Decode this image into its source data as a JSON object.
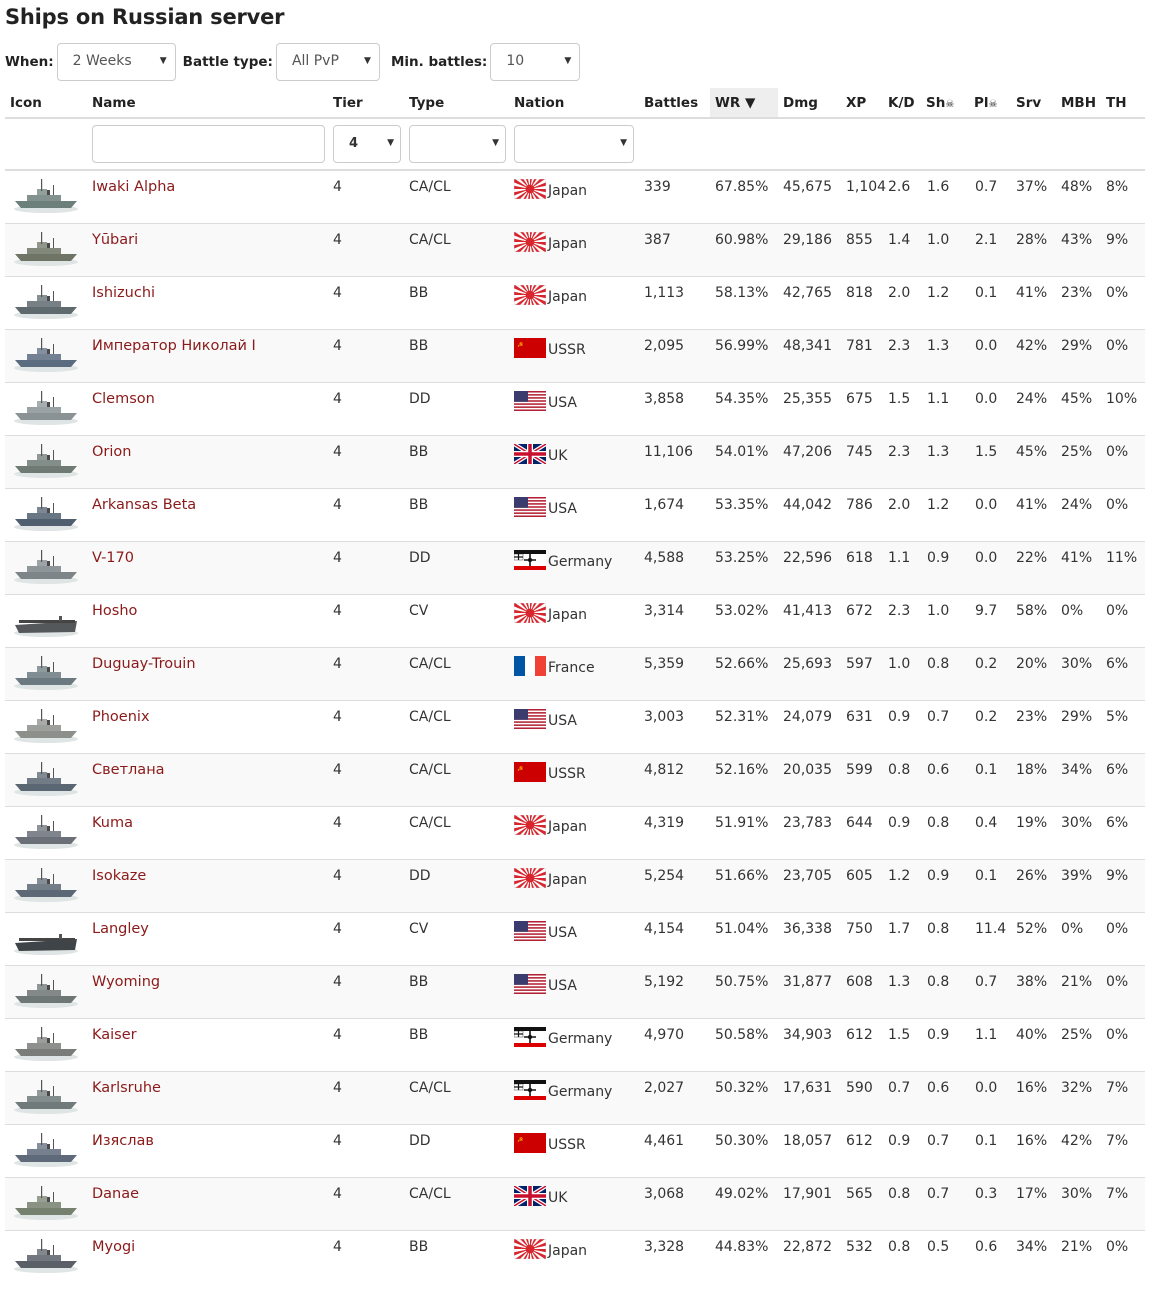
{
  "page_title": "Ships on Russian server",
  "filters": {
    "when_label": "When:",
    "when_value": "2 Weeks",
    "battle_type_label": "Battle type:",
    "battle_type_value": "All PvP",
    "min_battles_label": "Min. battles:",
    "min_battles_value": "10"
  },
  "columns": [
    "Icon",
    "Name",
    "Tier",
    "Type",
    "Nation",
    "Battles",
    "WR",
    "Dmg",
    "XP",
    "K/D",
    "Sh",
    "Pl",
    "Srv",
    "MBH",
    "TH"
  ],
  "sort_indicator": "▼",
  "filter_row": {
    "name": "",
    "tier": "4",
    "type": "",
    "nation": ""
  },
  "colors": {
    "link": "#8b1a1a",
    "stripe": "#f9f9f9",
    "sorted_header": "#eee"
  },
  "ships": [
    {
      "name": "Iwaki Alpha",
      "tier": "4",
      "type": "CA/CL",
      "nation": "Japan",
      "flag": "japan",
      "battles": "339",
      "wr": "67.85%",
      "dmg": "45,675",
      "xp": "1,104",
      "kd": "2.6",
      "sh": "1.6",
      "pl": "0.7",
      "srv": "37%",
      "mbh": "48%",
      "th": "8%",
      "hull": "#6d7f7a"
    },
    {
      "name": "Yūbari",
      "tier": "4",
      "type": "CA/CL",
      "nation": "Japan",
      "flag": "japan",
      "battles": "387",
      "wr": "60.98%",
      "dmg": "29,186",
      "xp": "855",
      "kd": "1.4",
      "sh": "1.0",
      "pl": "2.1",
      "srv": "28%",
      "mbh": "43%",
      "th": "9%",
      "hull": "#6e7564"
    },
    {
      "name": "Ishizuchi",
      "tier": "4",
      "type": "BB",
      "nation": "Japan",
      "flag": "japan",
      "battles": "1,113",
      "wr": "58.13%",
      "dmg": "42,765",
      "xp": "818",
      "kd": "2.0",
      "sh": "1.2",
      "pl": "0.1",
      "srv": "41%",
      "mbh": "23%",
      "th": "0%",
      "hull": "#5f6a6f"
    },
    {
      "name": "Император Николай I",
      "tier": "4",
      "type": "BB",
      "nation": "USSR",
      "flag": "ussr",
      "battles": "2,095",
      "wr": "56.99%",
      "dmg": "48,341",
      "xp": "781",
      "kd": "2.3",
      "sh": "1.3",
      "pl": "0.0",
      "srv": "42%",
      "mbh": "29%",
      "th": "0%",
      "hull": "#5c6c80"
    },
    {
      "name": "Clemson",
      "tier": "4",
      "type": "DD",
      "nation": "USA",
      "flag": "usa",
      "battles": "3,858",
      "wr": "54.35%",
      "dmg": "25,355",
      "xp": "675",
      "kd": "1.5",
      "sh": "1.1",
      "pl": "0.0",
      "srv": "24%",
      "mbh": "45%",
      "th": "10%",
      "hull": "#8a9296"
    },
    {
      "name": "Orion",
      "tier": "4",
      "type": "BB",
      "nation": "UK",
      "flag": "uk",
      "battles": "11,106",
      "wr": "54.01%",
      "dmg": "47,206",
      "xp": "745",
      "kd": "2.3",
      "sh": "1.3",
      "pl": "1.5",
      "srv": "45%",
      "mbh": "25%",
      "th": "0%",
      "hull": "#6f7a75"
    },
    {
      "name": "Arkansas Beta",
      "tier": "4",
      "type": "BB",
      "nation": "USA",
      "flag": "usa",
      "battles": "1,674",
      "wr": "53.35%",
      "dmg": "44,042",
      "xp": "786",
      "kd": "2.0",
      "sh": "1.2",
      "pl": "0.0",
      "srv": "41%",
      "mbh": "24%",
      "th": "0%",
      "hull": "#4f5f70"
    },
    {
      "name": "V-170",
      "tier": "4",
      "type": "DD",
      "nation": "Germany",
      "flag": "germany",
      "battles": "4,588",
      "wr": "53.25%",
      "dmg": "22,596",
      "xp": "618",
      "kd": "1.1",
      "sh": "0.9",
      "pl": "0.0",
      "srv": "22%",
      "mbh": "41%",
      "th": "11%",
      "hull": "#7d8589"
    },
    {
      "name": "Hosho",
      "tier": "4",
      "type": "CV",
      "nation": "Japan",
      "flag": "japan",
      "battles": "3,314",
      "wr": "53.02%",
      "dmg": "41,413",
      "xp": "672",
      "kd": "2.3",
      "sh": "1.0",
      "pl": "9.7",
      "srv": "58%",
      "mbh": "0%",
      "th": "0%",
      "hull": "#55585a"
    },
    {
      "name": "Duguay-Trouin",
      "tier": "4",
      "type": "CA/CL",
      "nation": "France",
      "flag": "france",
      "battles": "5,359",
      "wr": "52.66%",
      "dmg": "25,693",
      "xp": "597",
      "kd": "1.0",
      "sh": "0.8",
      "pl": "0.2",
      "srv": "20%",
      "mbh": "30%",
      "th": "6%",
      "hull": "#6b7a80"
    },
    {
      "name": "Phoenix",
      "tier": "4",
      "type": "CA/CL",
      "nation": "USA",
      "flag": "usa",
      "battles": "3,003",
      "wr": "52.31%",
      "dmg": "24,079",
      "xp": "631",
      "kd": "0.9",
      "sh": "0.7",
      "pl": "0.2",
      "srv": "23%",
      "mbh": "29%",
      "th": "5%",
      "hull": "#8d8f8a"
    },
    {
      "name": "Светлана",
      "tier": "4",
      "type": "CA/CL",
      "nation": "USSR",
      "flag": "ussr",
      "battles": "4,812",
      "wr": "52.16%",
      "dmg": "20,035",
      "xp": "599",
      "kd": "0.8",
      "sh": "0.6",
      "pl": "0.1",
      "srv": "18%",
      "mbh": "34%",
      "th": "6%",
      "hull": "#5a6672"
    },
    {
      "name": "Kuma",
      "tier": "4",
      "type": "CA/CL",
      "nation": "Japan",
      "flag": "japan",
      "battles": "4,319",
      "wr": "51.91%",
      "dmg": "23,783",
      "xp": "644",
      "kd": "0.9",
      "sh": "0.8",
      "pl": "0.4",
      "srv": "19%",
      "mbh": "30%",
      "th": "6%",
      "hull": "#6a6f78"
    },
    {
      "name": "Isokaze",
      "tier": "4",
      "type": "DD",
      "nation": "Japan",
      "flag": "japan",
      "battles": "5,254",
      "wr": "51.66%",
      "dmg": "23,705",
      "xp": "605",
      "kd": "1.2",
      "sh": "0.9",
      "pl": "0.1",
      "srv": "26%",
      "mbh": "39%",
      "th": "9%",
      "hull": "#5d6876"
    },
    {
      "name": "Langley",
      "tier": "4",
      "type": "CV",
      "nation": "USA",
      "flag": "usa",
      "battles": "4,154",
      "wr": "51.04%",
      "dmg": "36,338",
      "xp": "750",
      "kd": "1.7",
      "sh": "0.8",
      "pl": "11.4",
      "srv": "52%",
      "mbh": "0%",
      "th": "0%",
      "hull": "#3f4448"
    },
    {
      "name": "Wyoming",
      "tier": "4",
      "type": "BB",
      "nation": "USA",
      "flag": "usa",
      "battles": "5,192",
      "wr": "50.75%",
      "dmg": "31,877",
      "xp": "608",
      "kd": "1.3",
      "sh": "0.8",
      "pl": "0.7",
      "srv": "38%",
      "mbh": "21%",
      "th": "0%",
      "hull": "#6e7676"
    },
    {
      "name": "Kaiser",
      "tier": "4",
      "type": "BB",
      "nation": "Germany",
      "flag": "germany",
      "battles": "4,970",
      "wr": "50.58%",
      "dmg": "34,903",
      "xp": "612",
      "kd": "1.5",
      "sh": "0.9",
      "pl": "1.1",
      "srv": "40%",
      "mbh": "25%",
      "th": "0%",
      "hull": "#7a7c7a"
    },
    {
      "name": "Karlsruhe",
      "tier": "4",
      "type": "CA/CL",
      "nation": "Germany",
      "flag": "germany",
      "battles": "2,027",
      "wr": "50.32%",
      "dmg": "17,631",
      "xp": "590",
      "kd": "0.7",
      "sh": "0.6",
      "pl": "0.0",
      "srv": "16%",
      "mbh": "32%",
      "th": "7%",
      "hull": "#707a7a"
    },
    {
      "name": "Изяслав",
      "tier": "4",
      "type": "DD",
      "nation": "USSR",
      "flag": "ussr",
      "battles": "4,461",
      "wr": "50.30%",
      "dmg": "18,057",
      "xp": "612",
      "kd": "0.9",
      "sh": "0.7",
      "pl": "0.1",
      "srv": "16%",
      "mbh": "42%",
      "th": "7%",
      "hull": "#5e6a7a"
    },
    {
      "name": "Danae",
      "tier": "4",
      "type": "CA/CL",
      "nation": "UK",
      "flag": "uk",
      "battles": "3,068",
      "wr": "49.02%",
      "dmg": "17,901",
      "xp": "565",
      "kd": "0.8",
      "sh": "0.7",
      "pl": "0.3",
      "srv": "17%",
      "mbh": "30%",
      "th": "7%",
      "hull": "#76806f"
    },
    {
      "name": "Myogi",
      "tier": "4",
      "type": "BB",
      "nation": "Japan",
      "flag": "japan",
      "battles": "3,328",
      "wr": "44.83%",
      "dmg": "22,872",
      "xp": "532",
      "kd": "0.8",
      "sh": "0.5",
      "pl": "0.6",
      "srv": "34%",
      "mbh": "21%",
      "th": "0%",
      "hull": "#5a5f68"
    }
  ]
}
